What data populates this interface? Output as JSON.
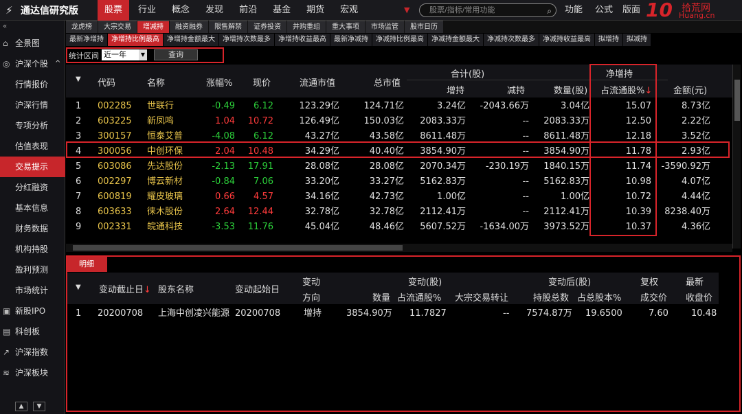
{
  "app": {
    "title": "通达信研究版"
  },
  "menu": [
    "股票",
    "行业",
    "概念",
    "发现",
    "前沿",
    "基金",
    "期货",
    "宏观"
  ],
  "search": {
    "placeholder": "股票/指标/常用功能"
  },
  "right_menu": [
    "功能",
    "公式",
    "版面"
  ],
  "brand": {
    "big": "10",
    "cn": "拾荒网",
    "en": "Huang.cn"
  },
  "sidebar": {
    "collapse": "«",
    "items": [
      {
        "label": "全景图",
        "icon": "panorama-icon"
      },
      {
        "label": "沪深个股",
        "icon": "stock-icon",
        "expand": "^"
      },
      {
        "label": "行情报价"
      },
      {
        "label": "沪深行情"
      },
      {
        "label": "专项分析"
      },
      {
        "label": "估值表现"
      },
      {
        "label": "交易提示",
        "active": true
      },
      {
        "label": "分红融资"
      },
      {
        "label": "基本信息"
      },
      {
        "label": "财务数据"
      },
      {
        "label": "机构持股"
      },
      {
        "label": "盈利预测"
      },
      {
        "label": "市场统计"
      },
      {
        "label": "新股IPO",
        "icon": "ipo-icon"
      },
      {
        "label": "科创板",
        "icon": "star-board-icon"
      },
      {
        "label": "沪深指数",
        "icon": "index-icon"
      },
      {
        "label": "沪深板块",
        "icon": "sector-icon"
      }
    ]
  },
  "tabs1": [
    "龙虎榜",
    "大宗交易",
    "增减持",
    "融资融券",
    "限售解禁",
    "证券投资",
    "并购重组",
    "重大事项",
    "市场监管",
    "股市日历"
  ],
  "tabs2": [
    "最新净增持",
    "净增持比例最高",
    "净增持金额最大",
    "净增持次数最多",
    "净增持收益最高",
    "最新净减持",
    "净减持比例最高",
    "净减持金额最大",
    "净减持次数最多",
    "净减持收益最高",
    "拟增持",
    "拟减持"
  ],
  "filter": {
    "label": "统计区间",
    "value": "近一年",
    "button": "查询"
  },
  "table": {
    "headers": {
      "code": "代码",
      "name": "名称",
      "chg": "涨幅%",
      "price": "现价",
      "float_cap": "流通市值",
      "total_cap": "总市值",
      "group_total": "合计(股)",
      "inc": "增持",
      "dec": "减持",
      "qty": "数量(股)",
      "group_net": "净增持",
      "pct": "占流通股%",
      "amt": "金额(元)",
      "sort_mark": "↓"
    },
    "rows": [
      {
        "no": "1",
        "code": "002285",
        "name": "世联行",
        "chg": "-0.49",
        "price": "6.12",
        "float_cap": "123.29亿",
        "total_cap": "124.71亿",
        "inc": "3.24亿",
        "dec": "-2043.66万",
        "qty": "3.04亿",
        "pct": "15.07",
        "amt": "8.73亿",
        "dir": "dn"
      },
      {
        "no": "2",
        "code": "603225",
        "name": "新凤鸣",
        "chg": "1.04",
        "price": "10.72",
        "float_cap": "126.49亿",
        "total_cap": "150.03亿",
        "inc": "2083.33万",
        "dec": "--",
        "qty": "2083.33万",
        "pct": "12.50",
        "amt": "2.22亿",
        "dir": "up"
      },
      {
        "no": "3",
        "code": "300157",
        "name": "恒泰艾普",
        "chg": "-4.08",
        "price": "6.12",
        "float_cap": "43.27亿",
        "total_cap": "43.58亿",
        "inc": "8611.48万",
        "dec": "--",
        "qty": "8611.48万",
        "pct": "12.18",
        "amt": "3.52亿",
        "dir": "dn"
      },
      {
        "no": "4",
        "code": "300056",
        "name": "中创环保",
        "chg": "2.04",
        "price": "10.48",
        "float_cap": "34.29亿",
        "total_cap": "40.40亿",
        "inc": "3854.90万",
        "dec": "--",
        "qty": "3854.90万",
        "pct": "11.78",
        "amt": "2.93亿",
        "dir": "up"
      },
      {
        "no": "5",
        "code": "603086",
        "name": "先达股份",
        "chg": "-2.13",
        "price": "17.91",
        "float_cap": "28.08亿",
        "total_cap": "28.08亿",
        "inc": "2070.34万",
        "dec": "-230.19万",
        "qty": "1840.15万",
        "pct": "11.74",
        "amt": "-3590.92万",
        "dir": "dn"
      },
      {
        "no": "6",
        "code": "002297",
        "name": "博云新材",
        "chg": "-0.84",
        "price": "7.06",
        "float_cap": "33.20亿",
        "total_cap": "33.27亿",
        "inc": "5162.83万",
        "dec": "--",
        "qty": "5162.83万",
        "pct": "10.98",
        "amt": "4.07亿",
        "dir": "dn"
      },
      {
        "no": "7",
        "code": "600819",
        "name": "耀皮玻璃",
        "chg": "0.66",
        "price": "4.57",
        "float_cap": "34.16亿",
        "total_cap": "42.73亿",
        "inc": "1.00亿",
        "dec": "--",
        "qty": "1.00亿",
        "pct": "10.72",
        "amt": "4.44亿",
        "dir": "up"
      },
      {
        "no": "8",
        "code": "603633",
        "name": "徕木股份",
        "chg": "2.64",
        "price": "12.44",
        "float_cap": "32.78亿",
        "total_cap": "32.78亿",
        "inc": "2112.41万",
        "dec": "--",
        "qty": "2112.41万",
        "pct": "10.39",
        "amt": "8238.40万",
        "dir": "up"
      },
      {
        "no": "9",
        "code": "002331",
        "name": "皖通科技",
        "chg": "-3.53",
        "price": "11.76",
        "float_cap": "45.04亿",
        "total_cap": "48.46亿",
        "inc": "5607.52万",
        "dec": "-1634.00万",
        "qty": "3973.52万",
        "pct": "10.37",
        "amt": "4.36亿",
        "dir": "dn"
      }
    ]
  },
  "detail": {
    "tab": "明细",
    "headers": {
      "end_date": "变动截止日",
      "holder": "股东名称",
      "start_date": "变动起始日",
      "change_top": "变动",
      "change_dir": "方向",
      "change_shares": "变动(股)",
      "qty": "数量",
      "pct_float": "占流通股%",
      "block": "大宗交易转让",
      "after": "变动后(股)",
      "total_hold": "持股总数",
      "pct_total": "占总股本%",
      "rights": "复权",
      "avg_price": "成交价",
      "latest": "最新",
      "close": "收盘价",
      "sort_mark": "↓"
    },
    "rows": [
      {
        "no": "1",
        "end_date": "20200708",
        "holder": "上海中创凌兴能源",
        "start_date": "20200708",
        "dir": "增持",
        "qty": "3854.90万",
        "pct_float": "11.7827",
        "block": "--",
        "total_hold": "7574.87万",
        "pct_total": "19.6500",
        "avg_price": "7.60",
        "close": "10.48"
      }
    ]
  }
}
